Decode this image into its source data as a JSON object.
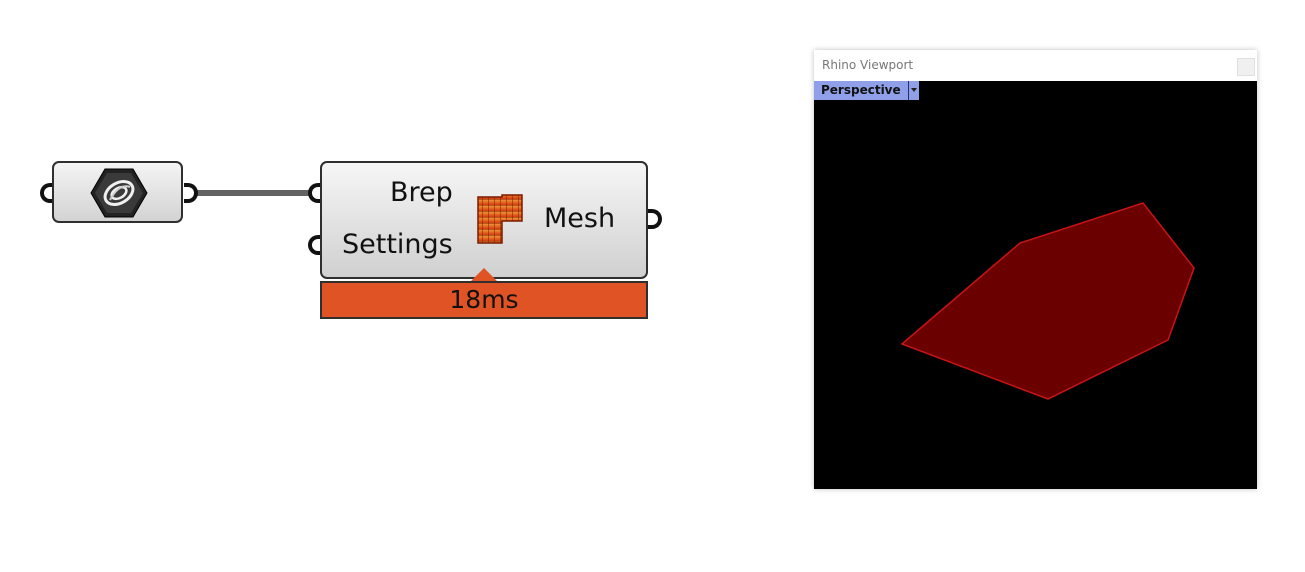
{
  "component": {
    "inputs": [
      "Brep",
      "Settings"
    ],
    "output": "Mesh",
    "timer": "18ms",
    "timer_color": "#e05325"
  },
  "viewport": {
    "window_title": "Rhino Viewport",
    "view_name": "Perspective",
    "mesh_fill": "#6b0000",
    "mesh_edge": "#c81414",
    "background": "#000000"
  },
  "icons": {
    "brep_param": "brep-param-icon",
    "mesh_brep": "mesh-brep-icon"
  }
}
